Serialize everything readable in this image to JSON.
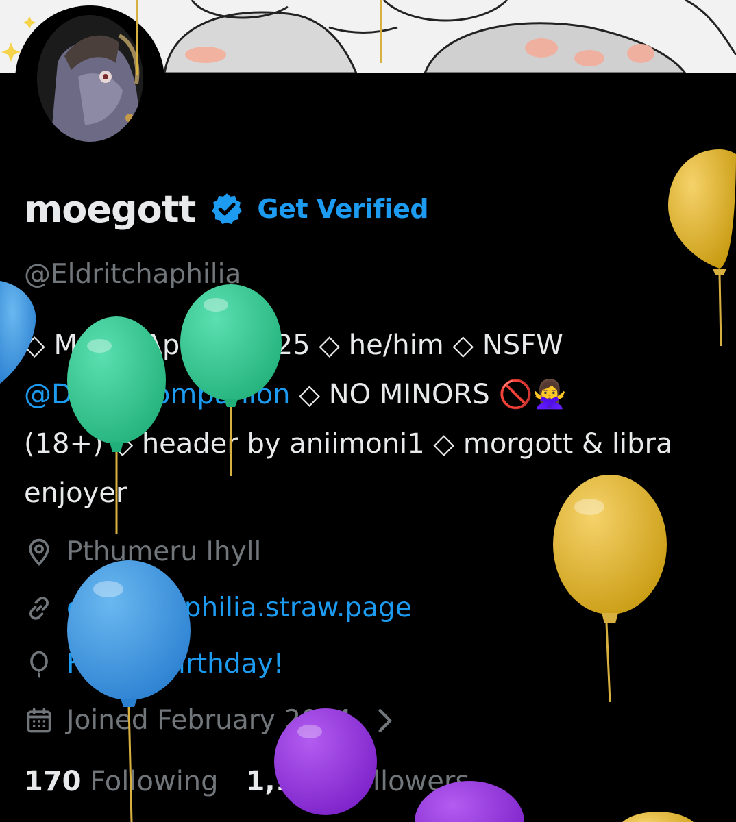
{
  "profile": {
    "display_name": "moegott",
    "get_verified_label": "Get Verified",
    "handle": "@Eldritchaphilia",
    "bio": {
      "line1": "◇ Movel Aphilia ◇ 25 ◇ he/him ◇ NSFW",
      "line2_mention": "@DeathCompanion",
      "line2_rest": " ◇ NO MINORS 🚫🙅‍♀️",
      "line3": "(18+) ◇ header by aniimoni1 ◇ morgott & libra",
      "line4": "enjoyer"
    },
    "location": "Pthumeru Ihyll",
    "website": "eldritchaphilia.straw.page",
    "birthday": "Happy birthday!",
    "joined": "Joined February 2024",
    "following_count": "170",
    "following_label": "Following",
    "followers_count": "1,127",
    "followers_label": "Followers"
  },
  "icons": {
    "verified": "verified-badge-icon",
    "location": "location-pin-icon",
    "website": "link-icon",
    "birthday": "balloon-icon",
    "joined": "calendar-icon",
    "chevron": "chevron-right-icon"
  },
  "colors": {
    "accent": "#1d9bf0",
    "muted": "#71767b",
    "text": "#e7e9ea",
    "background": "#000000"
  }
}
